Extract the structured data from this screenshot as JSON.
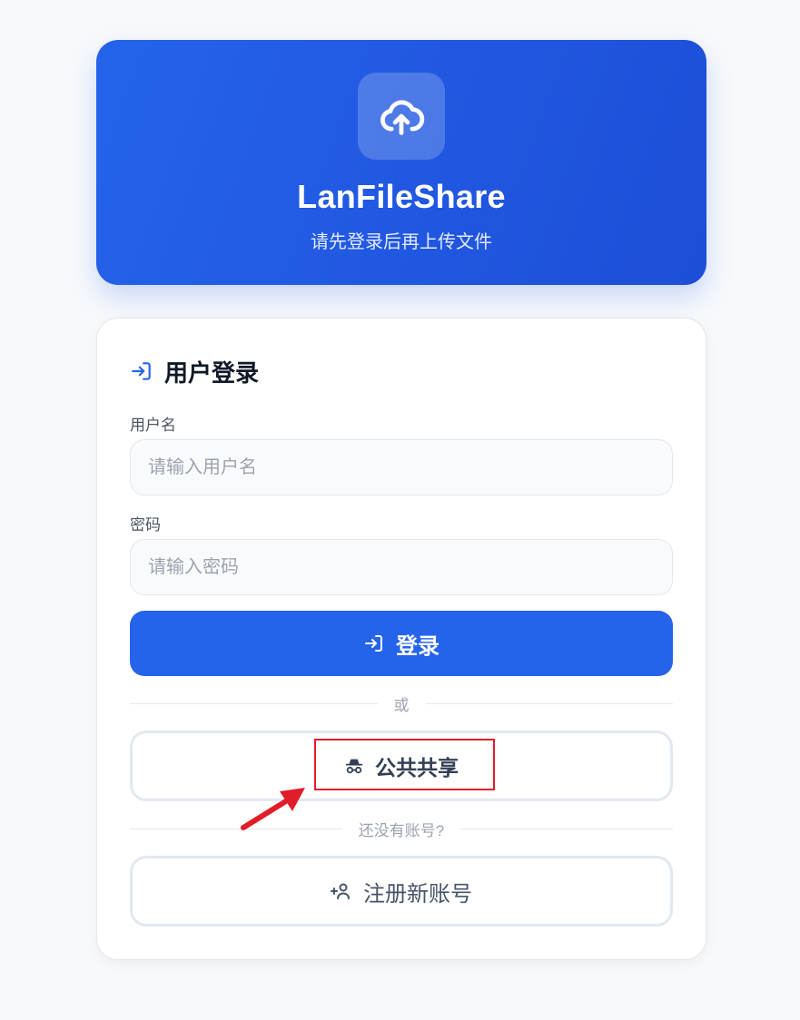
{
  "header": {
    "app_name": "LanFileShare",
    "subtitle": "请先登录后再上传文件",
    "icon": "cloud-upload-icon"
  },
  "login_card": {
    "title": "用户登录",
    "title_icon": "login-icon",
    "username": {
      "label": "用户名",
      "placeholder": "请输入用户名",
      "value": ""
    },
    "password": {
      "label": "密码",
      "placeholder": "请输入密码",
      "value": ""
    },
    "login_button": {
      "label": "登录",
      "icon": "login-icon"
    },
    "or_divider": "或",
    "public_share_button": {
      "label": "公共共享",
      "icon": "incognito-icon"
    },
    "no_account_divider": "还没有账号?",
    "register_button": {
      "label": "注册新账号",
      "icon": "user-plus-icon"
    }
  },
  "colors": {
    "primary": "#2563eb",
    "primary_dark": "#1d4ed8",
    "background": "#f8f9fb",
    "annotation": "#e11d2a"
  }
}
